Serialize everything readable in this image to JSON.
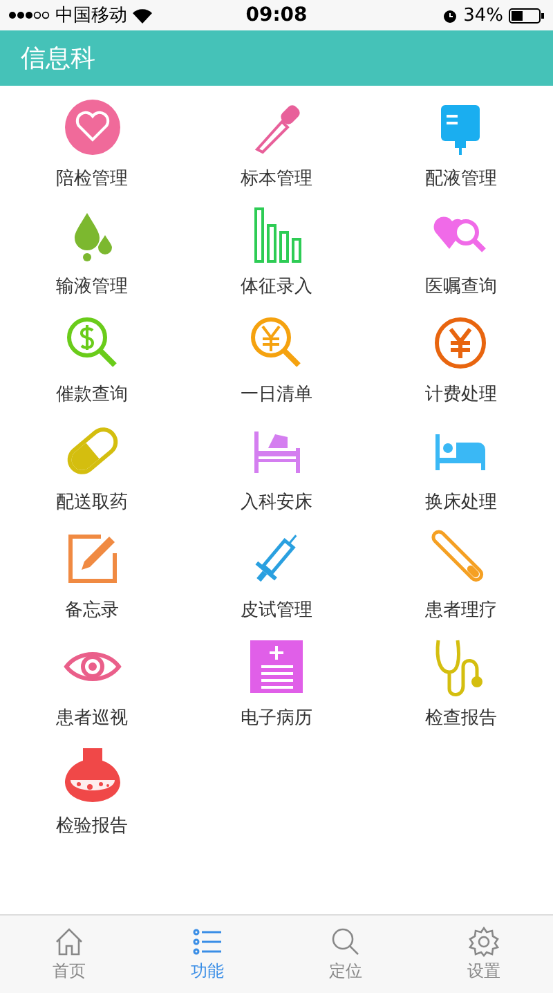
{
  "status_bar": {
    "carrier": "中国移动",
    "time": "09:08",
    "battery": "34%"
  },
  "header": {
    "title": "信息科"
  },
  "functions": [
    {
      "label": "陪检管理"
    },
    {
      "label": "标本管理"
    },
    {
      "label": "配液管理"
    },
    {
      "label": "输液管理"
    },
    {
      "label": "体征录入"
    },
    {
      "label": "医嘱查询"
    },
    {
      "label": "催款查询"
    },
    {
      "label": "一日清单"
    },
    {
      "label": "计费处理"
    },
    {
      "label": "配送取药"
    },
    {
      "label": "入科安床"
    },
    {
      "label": "换床处理"
    },
    {
      "label": "备忘录"
    },
    {
      "label": "皮试管理"
    },
    {
      "label": "患者理疗"
    },
    {
      "label": "患者巡视"
    },
    {
      "label": "电子病历"
    },
    {
      "label": "检查报告"
    },
    {
      "label": "检验报告"
    }
  ],
  "tab_bar": [
    {
      "label": "首页",
      "selected": false
    },
    {
      "label": "功能",
      "selected": true
    },
    {
      "label": "定位",
      "selected": false
    },
    {
      "label": "设置",
      "selected": false
    }
  ]
}
